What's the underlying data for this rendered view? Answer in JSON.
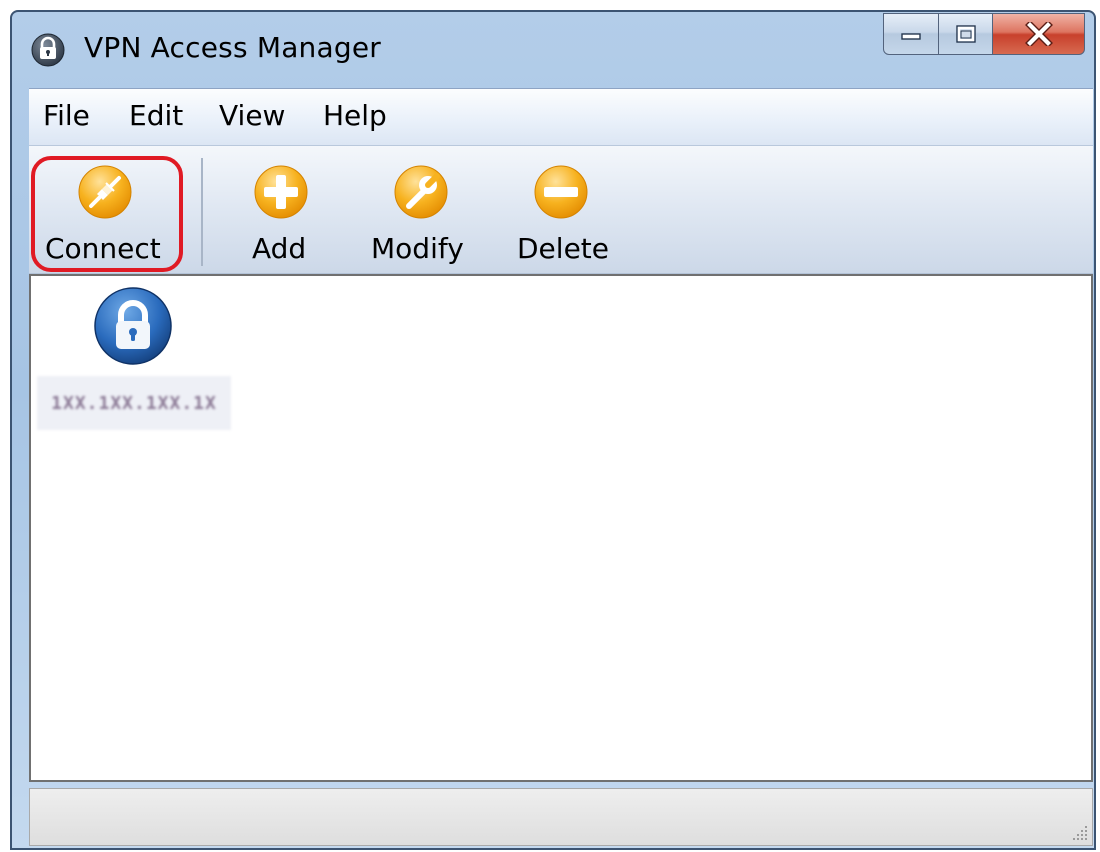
{
  "window": {
    "title": "VPN Access Manager"
  },
  "menu": [
    "File",
    "Edit",
    "View",
    "Help"
  ],
  "toolbar": {
    "connect": {
      "label": "Connect",
      "icon": "connect-plug-icon",
      "highlighted": true
    },
    "add": {
      "label": "Add",
      "icon": "plus-icon"
    },
    "modify": {
      "label": "Modify",
      "icon": "wrench-icon"
    },
    "delete": {
      "label": "Delete",
      "icon": "minus-icon"
    }
  },
  "connections": [
    {
      "label": "1XX.1XX.1XX.1X",
      "icon": "padlock-icon",
      "obscured": true
    }
  ],
  "colors": {
    "highlight": "#e01a24",
    "toolbar_icon": "#f5a623",
    "connection_icon": "#1f5fa8"
  }
}
